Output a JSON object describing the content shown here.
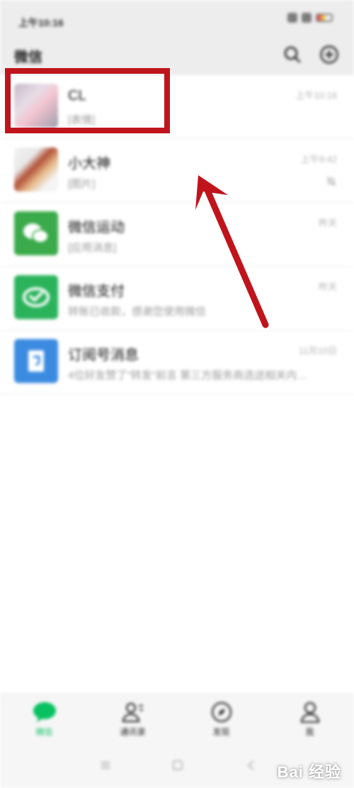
{
  "status_bar": {
    "time": "上午10:16"
  },
  "header": {
    "title": "微信"
  },
  "chats": [
    {
      "name": "CL",
      "preview": "[表情]",
      "time": "上午10:16",
      "avatar": "photo"
    },
    {
      "name": "小大神",
      "preview": "[图片]",
      "time": "上午9:42",
      "avatar": "food",
      "muted": true
    },
    {
      "name": "微信运动",
      "preview": "[应用消息]",
      "time": "昨天",
      "avatar": "wechat-sport-icon"
    },
    {
      "name": "微信支付",
      "preview": "转账已收款，感谢您使用微信",
      "time": "昨天",
      "avatar": "wechat-pay-icon"
    },
    {
      "name": "订阅号消息",
      "preview": "4位好友赞了\"转发\"前言 第三方服务商选送相关内容...",
      "time": "11月10日",
      "avatar": "subscription-icon"
    }
  ],
  "tabs": [
    {
      "label": "微信",
      "icon": "chat-bubble-icon",
      "active": true
    },
    {
      "label": "通讯录",
      "icon": "contacts-icon",
      "active": false
    },
    {
      "label": "发现",
      "icon": "compass-icon",
      "active": false
    },
    {
      "label": "我",
      "icon": "person-icon",
      "active": false
    }
  ],
  "watermark": "Bai 经验",
  "colors": {
    "accent": "#07c160",
    "annotation": "#c0141c",
    "header_bg": "#ededed"
  }
}
